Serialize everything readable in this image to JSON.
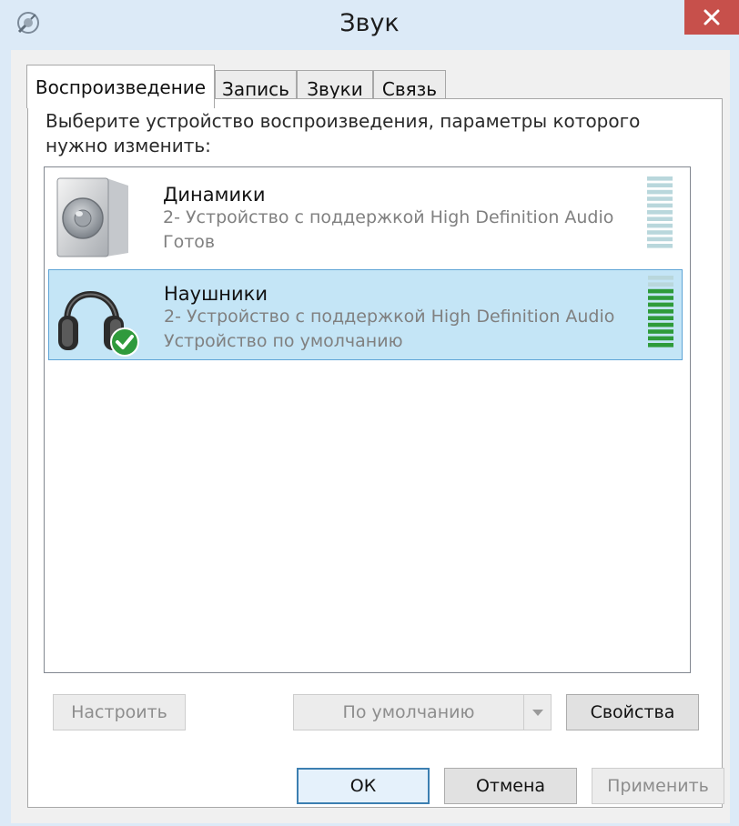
{
  "window": {
    "title": "Звук"
  },
  "tabs": [
    {
      "label": "Воспроизведение",
      "active": true
    },
    {
      "label": "Запись",
      "active": false
    },
    {
      "label": "Звуки",
      "active": false
    },
    {
      "label": "Связь",
      "active": false
    }
  ],
  "panel": {
    "prompt": "Выберите устройство воспроизведения, параметры которого нужно изменить:"
  },
  "devices": [
    {
      "name": "Динамики",
      "description": "2- Устройство с поддержкой High Definition Audio",
      "status": "Готов",
      "icon": "speaker-icon",
      "selected": false,
      "is_default": false,
      "level_bars_active": 0
    },
    {
      "name": "Наушники",
      "description": "2- Устройство с поддержкой High Definition Audio",
      "status": "Устройство по умолчанию",
      "icon": "headphones-icon",
      "selected": true,
      "is_default": true,
      "level_bars_active": 9
    }
  ],
  "actions": {
    "configure_label": "Настроить",
    "set_default_label": "По умолчанию",
    "properties_label": "Свойства"
  },
  "dialog_buttons": {
    "ok_label": "ОК",
    "cancel_label": "Отмена",
    "apply_label": "Применить"
  },
  "colors": {
    "selection_bg": "#c4e5f6",
    "selection_border": "#5ea4d6",
    "meter_active": "#2e9b3a",
    "meter_inactive": "#b9d7dc",
    "close_button": "#c7504b"
  }
}
